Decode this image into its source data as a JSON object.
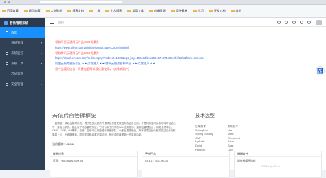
{
  "bookmarks": [
    {
      "label": "百度收藏"
    },
    {
      "label": "网页收藏"
    },
    {
      "label": "大学教程"
    },
    {
      "label": "博客文档"
    },
    {
      "label": "工具"
    },
    {
      "label": "个人博客"
    },
    {
      "label": "常用工具"
    },
    {
      "label": "前端资源"
    },
    {
      "label": "设计素材"
    },
    {
      "label": "学习"
    },
    {
      "label": "开发文档"
    },
    {
      "label": "其他"
    }
  ],
  "app": {
    "title": "若依管理系统"
  },
  "sidebar": {
    "items": [
      {
        "label": "首页",
        "active": true
      },
      {
        "label": "系统管理"
      },
      {
        "label": "系统监控"
      },
      {
        "label": "系统工具"
      },
      {
        "label": "若依官网"
      },
      {
        "label": "安全管理"
      }
    ]
  },
  "header": {
    "breadcrumb": "首页"
  },
  "notice": {
    "line1": "领取阿里云通用云产品1888优惠券",
    "line2": "https://www.aliyun.com/minisite/goods?userCode=brki8iof",
    "line3": "领取腾讯云通用云产品2860优惠券",
    "line4": "https://cloud.tencent.com/redirect.php?redirect=1025&cps_key=198c8df2ed259157187173bc7f4f32fd&from=console",
    "line5": "阿里云服务器折扣区 ►►点我进入◄◄ 腾讯云服务器秒杀区 ►►点我进入◄◄",
    "line6": "云产品通用红包，可叠加官网常规优惠使用。(仅限新用户)"
  },
  "intro": {
    "title": "若依后台管理框架",
    "description": "一直想做一款后台管理系统，看了很多优秀的开源项目但是发现没有合适自己的。于是利用空闲休息时间开始自己写一套后台系统。如此有了若依管理系统，它可以用于所有的Web应用程序，如网站管理后台，网站会员中心，CMS，CRM，OA等等。当然，您也可以对她进行深度定制，以做出更强系统。所有前端后台代码封装过后十分精简易上手，出错概率低。同时支持移动客户端访问。系统会陆续更新一些实用功能。",
    "version_label": "当前版本：",
    "version": "v3.8.6",
    "btn_primary": "访问码云",
    "btn_secondary": "访问主页"
  },
  "tech": {
    "title": "技术选型",
    "backend_label": "后端技术",
    "backend": [
      "SpringBoot",
      "Spring Security",
      "JWT",
      "MyBatis",
      "Druid",
      "Fastjson"
    ],
    "frontend_label": "前端技术",
    "frontend": [
      "Vue",
      "Vuex",
      "Element-ui",
      "Axios",
      "Sass",
      "Quill"
    ]
  },
  "cards": [
    {
      "title": "联系信息",
      "body": "官网：http://www.ruoyi.vip"
    },
    {
      "title": "更新日志",
      "body": "v3.8.6 - 2023-06-30"
    },
    {
      "title": "捐赠支持",
      "body": "请作者喝杯咖啡"
    }
  ],
  "watermark": "CSDN @xError"
}
